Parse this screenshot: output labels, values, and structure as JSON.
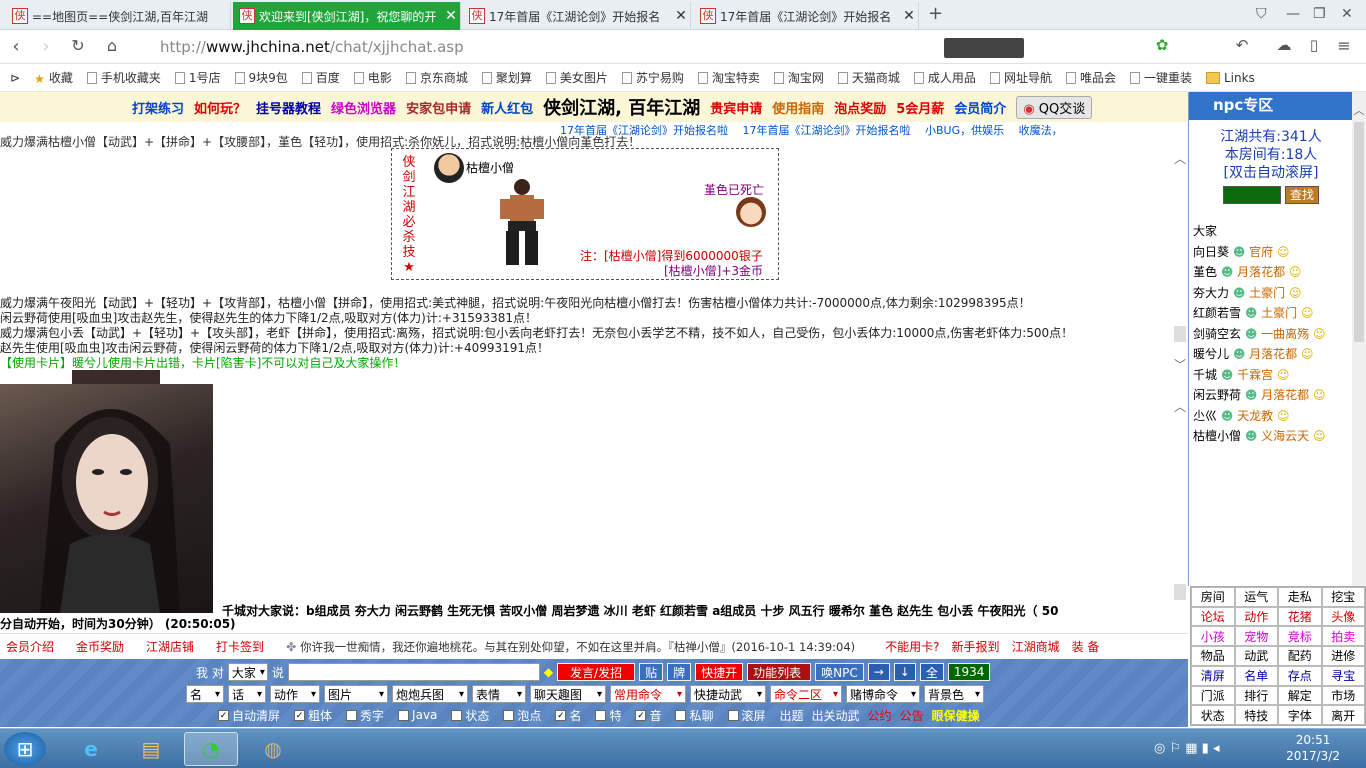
{
  "browser": {
    "tabs": [
      {
        "label": "==地图页==侠剑江湖,百年江湖",
        "active": false
      },
      {
        "label": "欢迎来到[侠剑江湖]，祝您聊的开",
        "active": true
      },
      {
        "label": "17年首届《江湖论剑》开始报名",
        "active": false
      },
      {
        "label": "17年首届《江湖论剑》开始报名",
        "active": false
      }
    ],
    "tab_favicon": "侠",
    "url_prefix": "http://",
    "url_host": "www.jhchina.net",
    "url_path": "/chat/xjjhchat.asp",
    "bookmarks": [
      "收藏",
      "手机收藏夹",
      "1号店",
      "9块9包",
      "百度",
      "电影",
      "京东商城",
      "聚划算",
      "美女图片",
      "苏宁易购",
      "淘宝特卖",
      "淘宝网",
      "天猫商城",
      "成人用品",
      "网址导航",
      "唯品会",
      "一键重装",
      "Links"
    ]
  },
  "chat": {
    "top_links": [
      "打架练习",
      "如何玩？",
      "挂号器教程",
      "绿色浏览器",
      "安家包申请",
      "新人红包",
      "侠剑江湖, 百年江湖",
      "贵宾申请",
      "使用指南",
      "泡点奖励",
      "5会月薪",
      "会员简介",
      "QQ交谈"
    ],
    "marquee": "17年首届《江湖论剑》开始报名啦　 17年首届《江湖论剑》开始报名啦　 小BUG，供娱乐　 收魔法，",
    "line0": "威力爆满枯檀小僧【动武】+【拼命】+【攻腰部】，堇色【轻功】，使用招式:杀你妩儿，招式说明:枯檀小僧向堇色打去！",
    "kill_box": {
      "vertical": [
        "侠",
        "剑",
        "江",
        "湖",
        "必",
        "杀",
        "技",
        "★"
      ],
      "attacker": "枯檀小僧",
      "victim_status": "堇色已死亡",
      "note1": "注：[枯檀小僧]得到6000000银子",
      "note2": "[枯檀小僧]+3金币"
    },
    "lines": [
      "威力爆满午夜阳光【动武】+【轻功】+【攻背部】，枯檀小僧【拼命】，使用招式:美式神腿，招式说明:午夜阳光向枯檀小僧打去！伤害枯檀小僧体力共计:-7000000点,体力剩余:102998395点！",
      "闲云野荷使用[吸血虫]攻击赵先生，使得赵先生的体力下降1/2点,吸取对方(体力)计:+31593381点！",
      "威力爆满包小丢【动武】+【轻功】+【攻头部】，老虾【拼命】，使用招式:离殇，招式说明:包小丢向老虾打去！无奈包小丢学艺不精，技不如人，自己受伤，包小丢体力:10000点,伤害老虾体力:500点！",
      "赵先生使用[吸血虫]攻击闲云野荷，使得闲云野荷的体力下降1/2点,吸取对方(体力)计:+40993191点！",
      "【使用卡片】暖兮儿使用卡片出错，卡片[陷害卡]不可以对自己及大家操作！"
    ],
    "talk_line": "千城对大家说：b组成员 夯大力 闲云野鹤 生死无惧 苦叹小僧 周岩梦遗 冰川 老虾 红颜若雪 a组成员 十步 风五行 暖希尔 堇色 赵先生 包小丢 午夜阳光（ 50",
    "auto_line": "分自动开始，时间为30分钟） (20:50:05)"
  },
  "infobar": {
    "left_links": [
      "会员介绍",
      "金币奖励",
      "江湖店铺",
      "打卡签到"
    ],
    "motto": "你许我一世痴情，我还你遍地桃花。与其在别处仰望，不如在这里并肩。『枯禅小僧』(2016-10-1 14:39:04)",
    "right_links": [
      "不能用卡?",
      "新手报到",
      "江湖商城",
      "装 备"
    ]
  },
  "control": {
    "row1": {
      "me_label": "我 对",
      "target": "大家",
      "say_label": "说",
      "buttons": [
        "发言/发招",
        "贴",
        "牌",
        "快捷开",
        "功能列表",
        "唤NPC",
        "→",
        "↓",
        "全",
        "1934"
      ]
    },
    "row2_selects": [
      "名",
      "话",
      "动作",
      "图片",
      "炮炮兵图",
      "表情",
      "聊天趣图",
      "常用命令",
      "快捷动武",
      "命令二区",
      "赌博命令",
      "背景色"
    ],
    "row3_checks": [
      {
        "label": "自动清屏",
        "checked": true
      },
      {
        "label": "粗体",
        "checked": true
      },
      {
        "label": "秀字",
        "checked": false
      },
      {
        "label": "Java",
        "checked": false
      },
      {
        "label": "状态",
        "checked": false
      },
      {
        "label": "泡点",
        "checked": false
      },
      {
        "label": "名",
        "checked": true
      },
      {
        "label": "特",
        "checked": false
      },
      {
        "label": "音",
        "checked": true
      },
      {
        "label": "私聊",
        "checked": false
      },
      {
        "label": "滚屏",
        "checked": false
      }
    ],
    "row3_links": [
      "出题",
      "出关动武",
      "公约",
      "公告",
      "眼保健操"
    ]
  },
  "npc_panel": {
    "title": "npc专区",
    "stat1": "江湖共有:341人",
    "stat2": "本房间有:18人",
    "autoscroll": "[双击自动滚屏]",
    "search_btn": "查找",
    "users": [
      {
        "name": "大家",
        "link": ""
      },
      {
        "name": "向日葵",
        "link": "官府"
      },
      {
        "name": "堇色",
        "link": "月落花都"
      },
      {
        "name": "夯大力",
        "link": "土豪门"
      },
      {
        "name": "红颜若雪",
        "link": "土豪门"
      },
      {
        "name": "剑骑空玄",
        "link": "一曲离殇"
      },
      {
        "name": "暖兮儿",
        "link": "月落花都"
      },
      {
        "name": "千城",
        "link": "千霖宫"
      },
      {
        "name": "闲云野荷",
        "link": "月落花都"
      },
      {
        "name": "尐巛",
        "link": "天龙教"
      },
      {
        "name": "枯檀小僧",
        "link": "义海云天"
      }
    ],
    "grid": [
      "房间",
      "运气",
      "走私",
      "挖宝",
      "论坛",
      "动作",
      "花猪",
      "头像",
      "小孩",
      "宠物",
      "竞标",
      "拍卖",
      "物品",
      "动武",
      "配药",
      "进修",
      "清屏",
      "名单",
      "存点",
      "寻宝",
      "门派",
      "排行",
      "解定",
      "市场",
      "状态",
      "特技",
      "字体",
      "离开"
    ]
  },
  "taskbar": {
    "time": "20:51",
    "date": "2017/3/2"
  }
}
